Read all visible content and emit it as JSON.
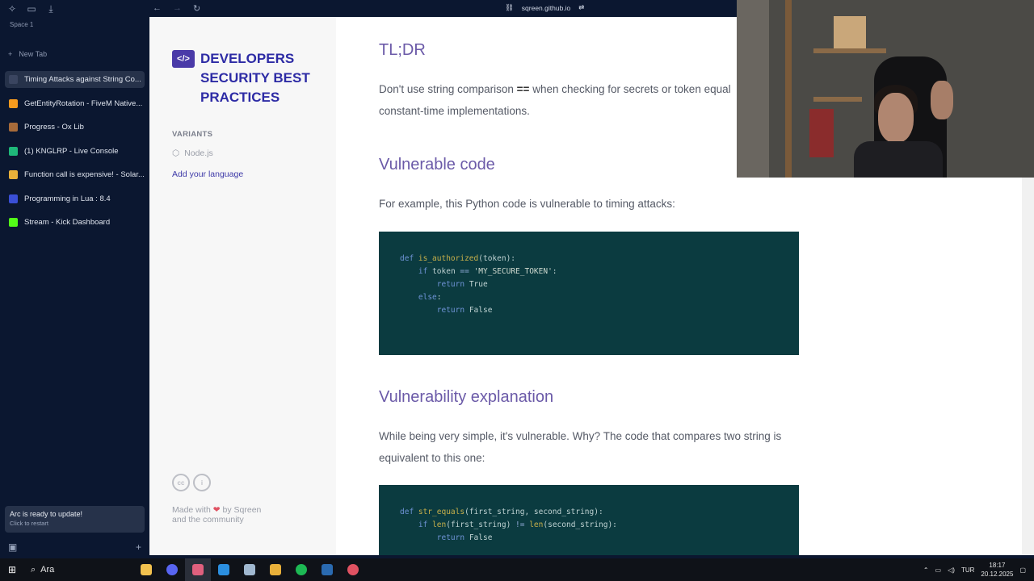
{
  "arc": {
    "space": "Space 1",
    "new_tab": "New Tab",
    "tabs": [
      {
        "label": "Timing Attacks against String Co...",
        "color": "#3a4560"
      },
      {
        "label": "GetEntityRotation - FiveM Native...",
        "color": "#f59a1e"
      },
      {
        "label": "Progress - Ox Lib",
        "color": "#a86b3a"
      },
      {
        "label": "(1) KNGLRP - Live Console",
        "color": "#1fb87a"
      },
      {
        "label": "Function call is expensive! - Solar...",
        "color": "#e8b03a"
      },
      {
        "label": "Programming in Lua : 8.4",
        "color": "#3a4fd6"
      },
      {
        "label": "Stream - Kick Dashboard",
        "color": "#53fc18"
      }
    ],
    "update_title": "Arc is ready to update!",
    "update_sub": "Click to restart"
  },
  "browser": {
    "url": "sqreen.github.io"
  },
  "doc": {
    "logo_text": "</>",
    "site_title": "DEVELOPERS SECURITY BEST PRACTICES",
    "variants_label": "VARIANTS",
    "variant": "Node.js",
    "add_language": "Add your language",
    "cc1": "cc",
    "cc2": "i",
    "made_prefix": "Made with",
    "made_suffix": "by Sqreen",
    "made_line2": "and the community",
    "heart": "❤"
  },
  "content": {
    "h_tldr": "TL;DR",
    "p_tldr_a": "Don't use string comparison",
    "p_tldr_op": "==",
    "p_tldr_b": "when checking for secrets or token equal",
    "p_tldr_c": "constant-time implementations.",
    "h_vuln": "Vulnerable code",
    "p_vuln": "For example, this Python code is vulnerable to timing attacks:",
    "h_expl": "Vulnerability explanation",
    "p_expl": "While being very simple, it's vulnerable. Why? The code that compares two string is equivalent to this one:",
    "code1": [
      {
        "kw": "def ",
        "fn": "is_authorized",
        "rest": "(token):"
      },
      {
        "indent": "    ",
        "kw": "if ",
        "rest": "token ",
        "op": "==",
        "str": " 'MY_SECURE_TOKEN'",
        "end": ":"
      },
      {
        "indent": "        ",
        "kw": "return ",
        "rest": "True"
      },
      {
        "indent": "    ",
        "kw": "else",
        "rest": ":"
      },
      {
        "indent": "        ",
        "kw": "return ",
        "rest": "False"
      }
    ],
    "code2": [
      {
        "kw": "def ",
        "fn": "str_equals",
        "rest": "(first_string, second_string):"
      },
      {
        "indent": "    ",
        "kw": "if ",
        "fn": "len",
        "rest": "(first_string) ",
        "op": "!=",
        "fn2": " len",
        "end": "(second_string):"
      },
      {
        "indent": "        ",
        "kw": "return ",
        "rest": "False"
      }
    ]
  },
  "taskbar": {
    "search": "Ara",
    "lang": "TUR",
    "time": "18:17",
    "date": "20.12.2025"
  }
}
